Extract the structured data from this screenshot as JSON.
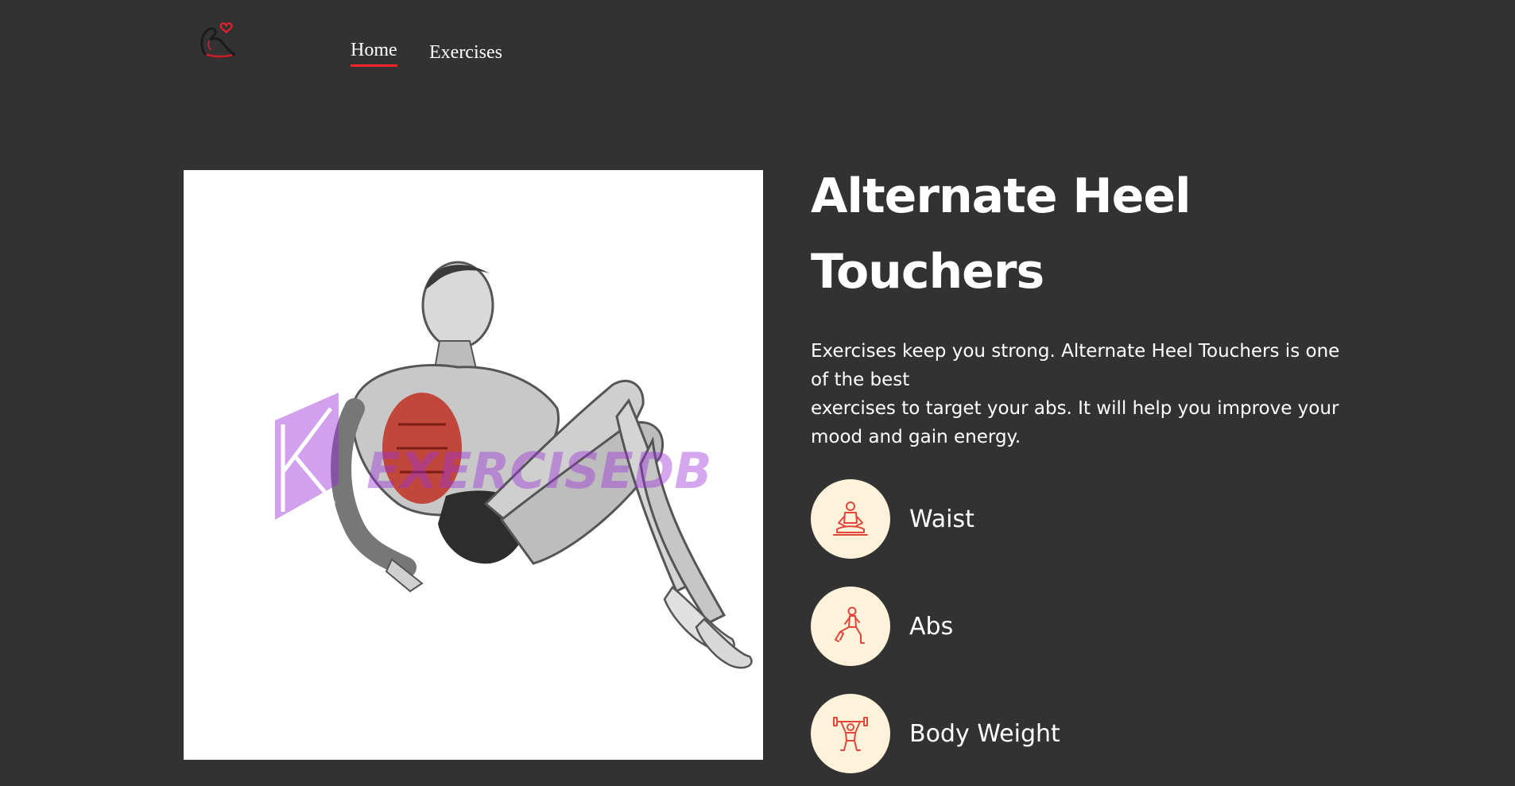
{
  "nav": {
    "logo_icon": "flexed-arm-heart-logo",
    "links": [
      {
        "label": "Home",
        "active": true
      },
      {
        "label": "Exercises",
        "active": false
      }
    ],
    "accent_color": "#ff2625"
  },
  "exercise": {
    "image_icon": "exercise-illustration",
    "watermark": "EXERCISEDB",
    "title": "Alternate Heel Touchers",
    "description_lines": [
      "Exercises keep you strong. Alternate Heel Touchers is one of the best",
      "exercises to target your abs. It will help you improve your mood and gain energy."
    ],
    "tags": [
      {
        "icon": "meditation-pose-icon",
        "label": "Waist"
      },
      {
        "icon": "lunge-pose-icon",
        "label": "Abs"
      },
      {
        "icon": "dumbbell-lift-icon",
        "label": "Body Weight"
      }
    ],
    "tag_bg_color": "#fff2db",
    "icon_color": "#e0473a"
  },
  "theme": {
    "background": "#323232",
    "text": "#ffffff"
  }
}
